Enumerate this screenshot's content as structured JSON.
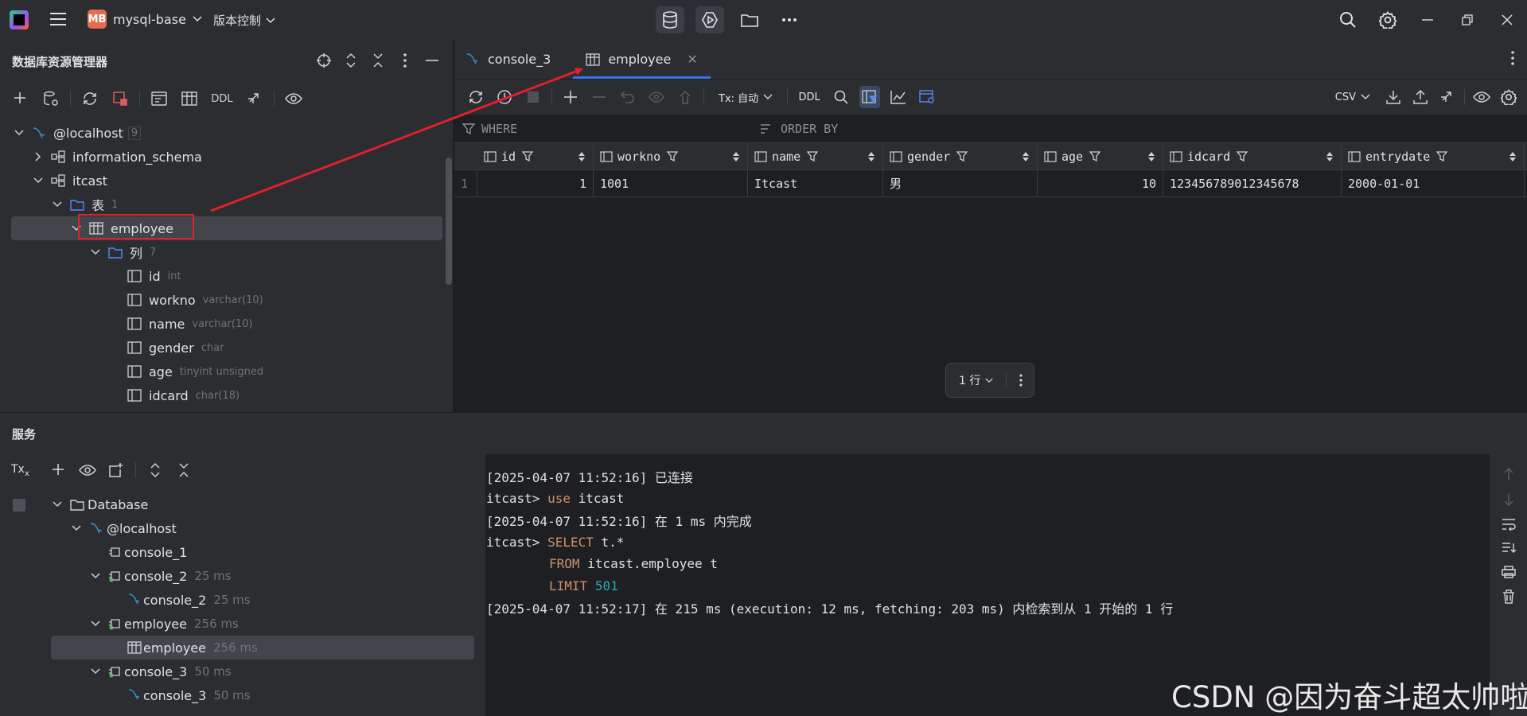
{
  "titlebar": {
    "project_badge": "MB",
    "project_name": "mysql-base",
    "vcs_label": "版本控制"
  },
  "db_explorer": {
    "title": "数据库资源管理器",
    "toolbar": {
      "ddl_label": "DDL"
    },
    "tree": [
      {
        "label": "@localhost",
        "meta": "9"
      },
      {
        "label": "information_schema",
        "meta": ""
      },
      {
        "label": "itcast",
        "meta": ""
      },
      {
        "label": "表",
        "meta": "1"
      },
      {
        "label": "employee",
        "meta": ""
      },
      {
        "label": "列",
        "meta": "7"
      },
      {
        "label": "id",
        "meta": "int"
      },
      {
        "label": "workno",
        "meta": "varchar(10)"
      },
      {
        "label": "name",
        "meta": "varchar(10)"
      },
      {
        "label": "gender",
        "meta": "char"
      },
      {
        "label": "age",
        "meta": "tinyint unsigned"
      },
      {
        "label": "idcard",
        "meta": "char(18)"
      }
    ]
  },
  "editor": {
    "tabs": [
      {
        "label": "console_3"
      },
      {
        "label": "employee"
      }
    ],
    "toolbar": {
      "tx_label": "Tx: 自动",
      "ddl_label": "DDL",
      "export_format": "CSV"
    },
    "filter": {
      "where": "WHERE",
      "order_by": "ORDER BY"
    },
    "grid": {
      "columns": [
        "id",
        "workno",
        "name",
        "gender",
        "age",
        "idcard",
        "entrydate"
      ],
      "rows": [
        {
          "num": "1",
          "cells": [
            "1",
            "1001",
            "Itcast",
            "男",
            "10",
            "123456789012345678",
            "2000-01-01"
          ]
        }
      ]
    },
    "pager": {
      "label": "1 行"
    }
  },
  "services": {
    "title": "服务",
    "tx_label": "Tx",
    "tree": [
      {
        "label": "Database",
        "meta": ""
      },
      {
        "label": "@localhost",
        "meta": ""
      },
      {
        "label": "console_1",
        "meta": ""
      },
      {
        "label": "console_2",
        "meta": "25 ms"
      },
      {
        "label": "console_2",
        "meta": "25 ms"
      },
      {
        "label": "employee",
        "meta": "256 ms"
      },
      {
        "label": "employee",
        "meta": "256 ms"
      },
      {
        "label": "console_3",
        "meta": "50 ms"
      },
      {
        "label": "console_3",
        "meta": "50 ms"
      }
    ],
    "console": {
      "line1": "[2025-04-07 11:52:16] 已连接",
      "line2_prompt": "itcast> ",
      "line2_kw": "use",
      "line2_rest": " itcast",
      "line3": "[2025-04-07 11:52:16] 在 1 ms 内完成",
      "line4_prompt": "itcast> ",
      "line4_kw": "SELECT",
      "line4_rest": " t.*",
      "line5_kw": "FROM",
      "line5_rest": " itcast.employee t",
      "line6_kw": "LIMIT",
      "line6_num": "501",
      "line7": "[2025-04-07 11:52:17] 在 215 ms (execution: 12 ms, fetching: 203 ms) 内检索到从 1 开始的 1 行"
    }
  },
  "watermark": "CSDN @因为奋斗超太帅啦",
  "colors": {
    "accent": "#3574f0",
    "annotation_red": "#e0212c",
    "keyword": "#cf8e6d",
    "number": "#2aacb8"
  }
}
